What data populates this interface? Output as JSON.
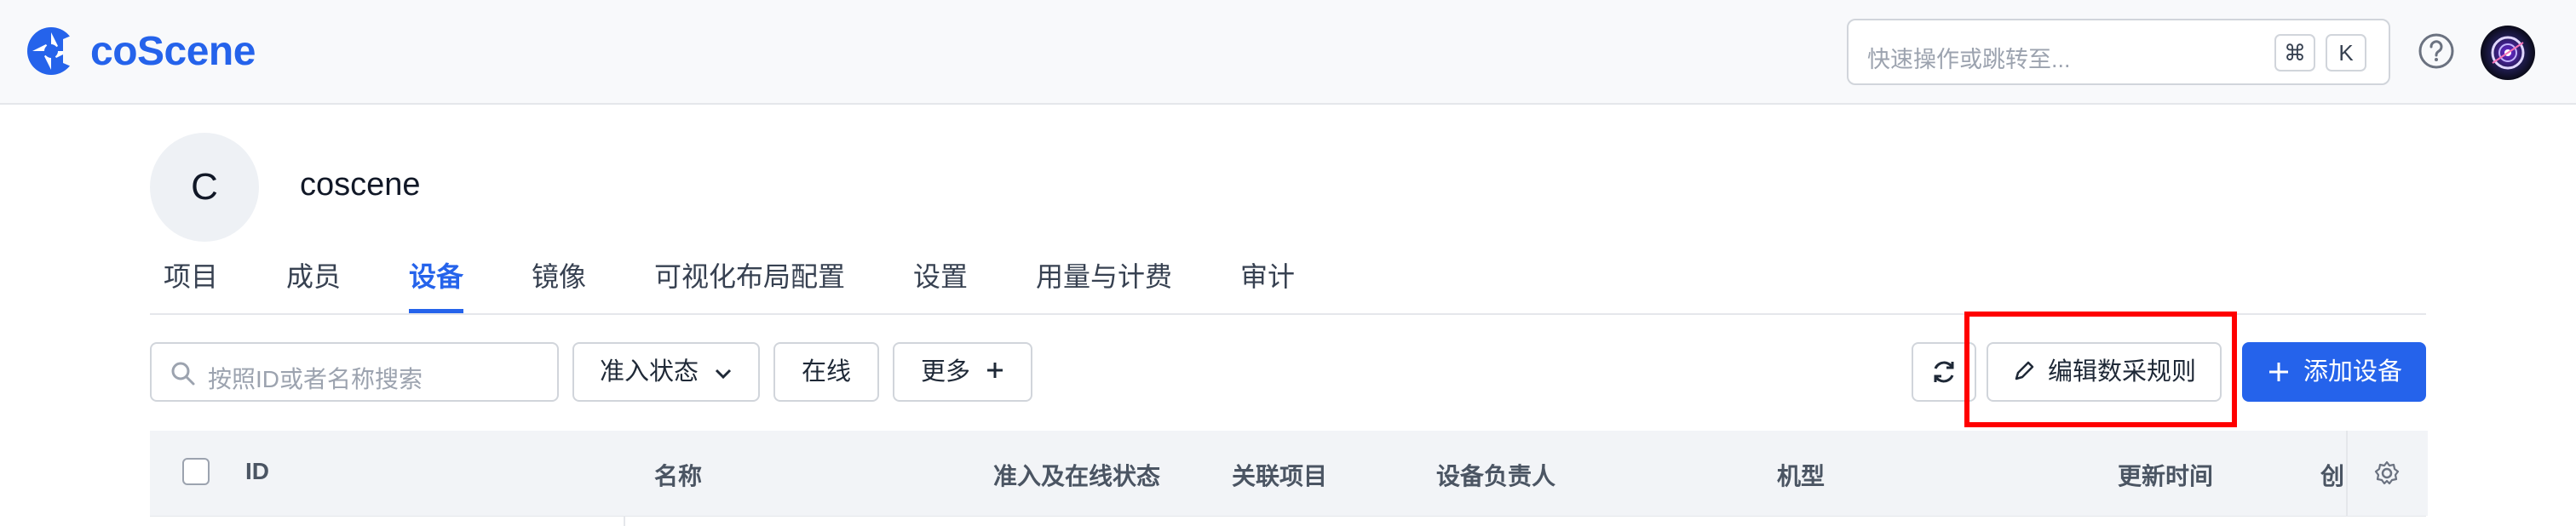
{
  "brand": {
    "name": "coScene",
    "accent": "#2563eb"
  },
  "header": {
    "search_placeholder": "快速操作或跳转至...",
    "shortcut_cmd": "⌘",
    "shortcut_key": "K"
  },
  "org": {
    "avatar_letter": "C",
    "name": "coscene"
  },
  "tabs": [
    "项目",
    "成员",
    "设备",
    "镜像",
    "可视化布局配置",
    "设置",
    "用量与计费",
    "审计"
  ],
  "active_tab_index": 2,
  "toolbar": {
    "search_placeholder": "按照ID或者名称搜索",
    "filter_access": "准入状态",
    "filter_online": "在线",
    "more": "更多",
    "edit_rules": "编辑数采规则",
    "add_device": "添加设备"
  },
  "table": {
    "columns": [
      "ID",
      "名称",
      "准入及在线状态",
      "关联项目",
      "设备负责人",
      "机型",
      "更新时间",
      "创"
    ]
  },
  "colors": {
    "highlight": "#ff0000",
    "primary": "#2563eb"
  }
}
